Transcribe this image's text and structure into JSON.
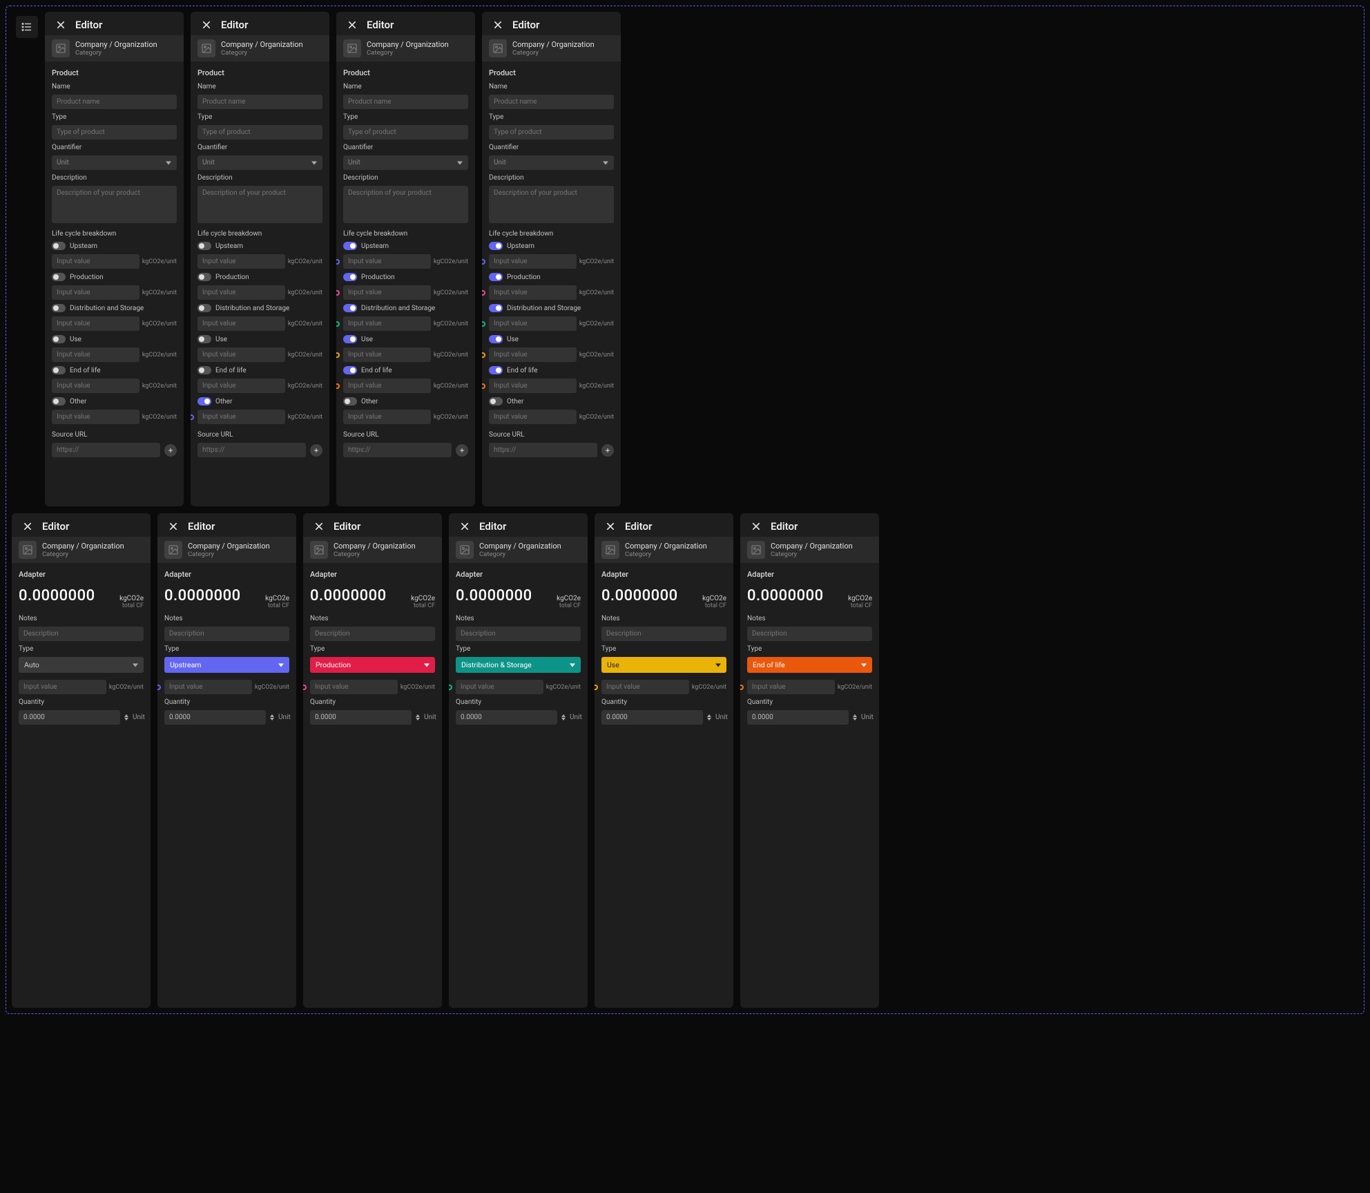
{
  "iconbar": {
    "name": "list-icon"
  },
  "common": {
    "editor_title": "Editor",
    "org_name": "Company / Organization",
    "org_sub": "Category",
    "product_section": "Product",
    "labels": {
      "name": "Name",
      "type": "Type",
      "quantifier": "Quantifier",
      "description": "Description",
      "life_cycle": "Life cycle breakdown",
      "source_url": "Source URL"
    },
    "placeholders": {
      "name": "Product name",
      "type": "Type of product",
      "desc": "Description of your product",
      "url": "https://",
      "input": "Input value"
    },
    "quantifier_value": "Unit",
    "life_unit": "kgCO2e/unit",
    "life_stages": [
      "Upsteam",
      "Production",
      "Distribution and Storage",
      "Use",
      "End of life",
      "Other"
    ]
  },
  "product_panels": [
    {
      "toggles": [
        false,
        false,
        false,
        false,
        false,
        false
      ],
      "markers": [
        "none",
        "none",
        "none",
        "none",
        "none",
        "none"
      ]
    },
    {
      "toggles": [
        false,
        false,
        false,
        false,
        false,
        true
      ],
      "markers": [
        "none",
        "none",
        "none",
        "none",
        "none",
        "mk-purple"
      ]
    },
    {
      "toggles": [
        true,
        true,
        true,
        true,
        true,
        false
      ],
      "markers": [
        "mk-purple",
        "mk-pink",
        "mk-teal",
        "mk-amber",
        "mk-orange",
        "none"
      ]
    },
    {
      "toggles": [
        true,
        true,
        true,
        true,
        true,
        false
      ],
      "markers": [
        "mk-purple",
        "mk-pink",
        "mk-teal",
        "mk-amber",
        "mk-orange",
        "none"
      ]
    }
  ],
  "adapter_common": {
    "section": "Adapter",
    "value": "0.0000000",
    "meta1": "kgCO2e",
    "meta2": "total CF",
    "notes_label": "Notes",
    "notes_ph": "Description",
    "type_label": "Type",
    "inp_ph": "Input value",
    "inp_unit": "kgCO2e/unit",
    "qty_label": "Quantity",
    "qty_val": "0.0000",
    "qty_unit": "Unit"
  },
  "adapter_panels": [
    {
      "type_display": "Auto",
      "type_class": "tc-auto auto",
      "marker": "none"
    },
    {
      "type_display": "Upstream",
      "type_class": "tc-upstream",
      "marker": "mk-purple"
    },
    {
      "type_display": "Production",
      "type_class": "tc-production",
      "marker": "mk-pink"
    },
    {
      "type_display": "Distribution & Storage",
      "type_class": "tc-dist",
      "marker": "mk-teal"
    },
    {
      "type_display": "Use",
      "type_class": "tc-use use",
      "marker": "mk-amber"
    },
    {
      "type_display": "End of life",
      "type_class": "tc-eol",
      "marker": "mk-orange"
    }
  ]
}
